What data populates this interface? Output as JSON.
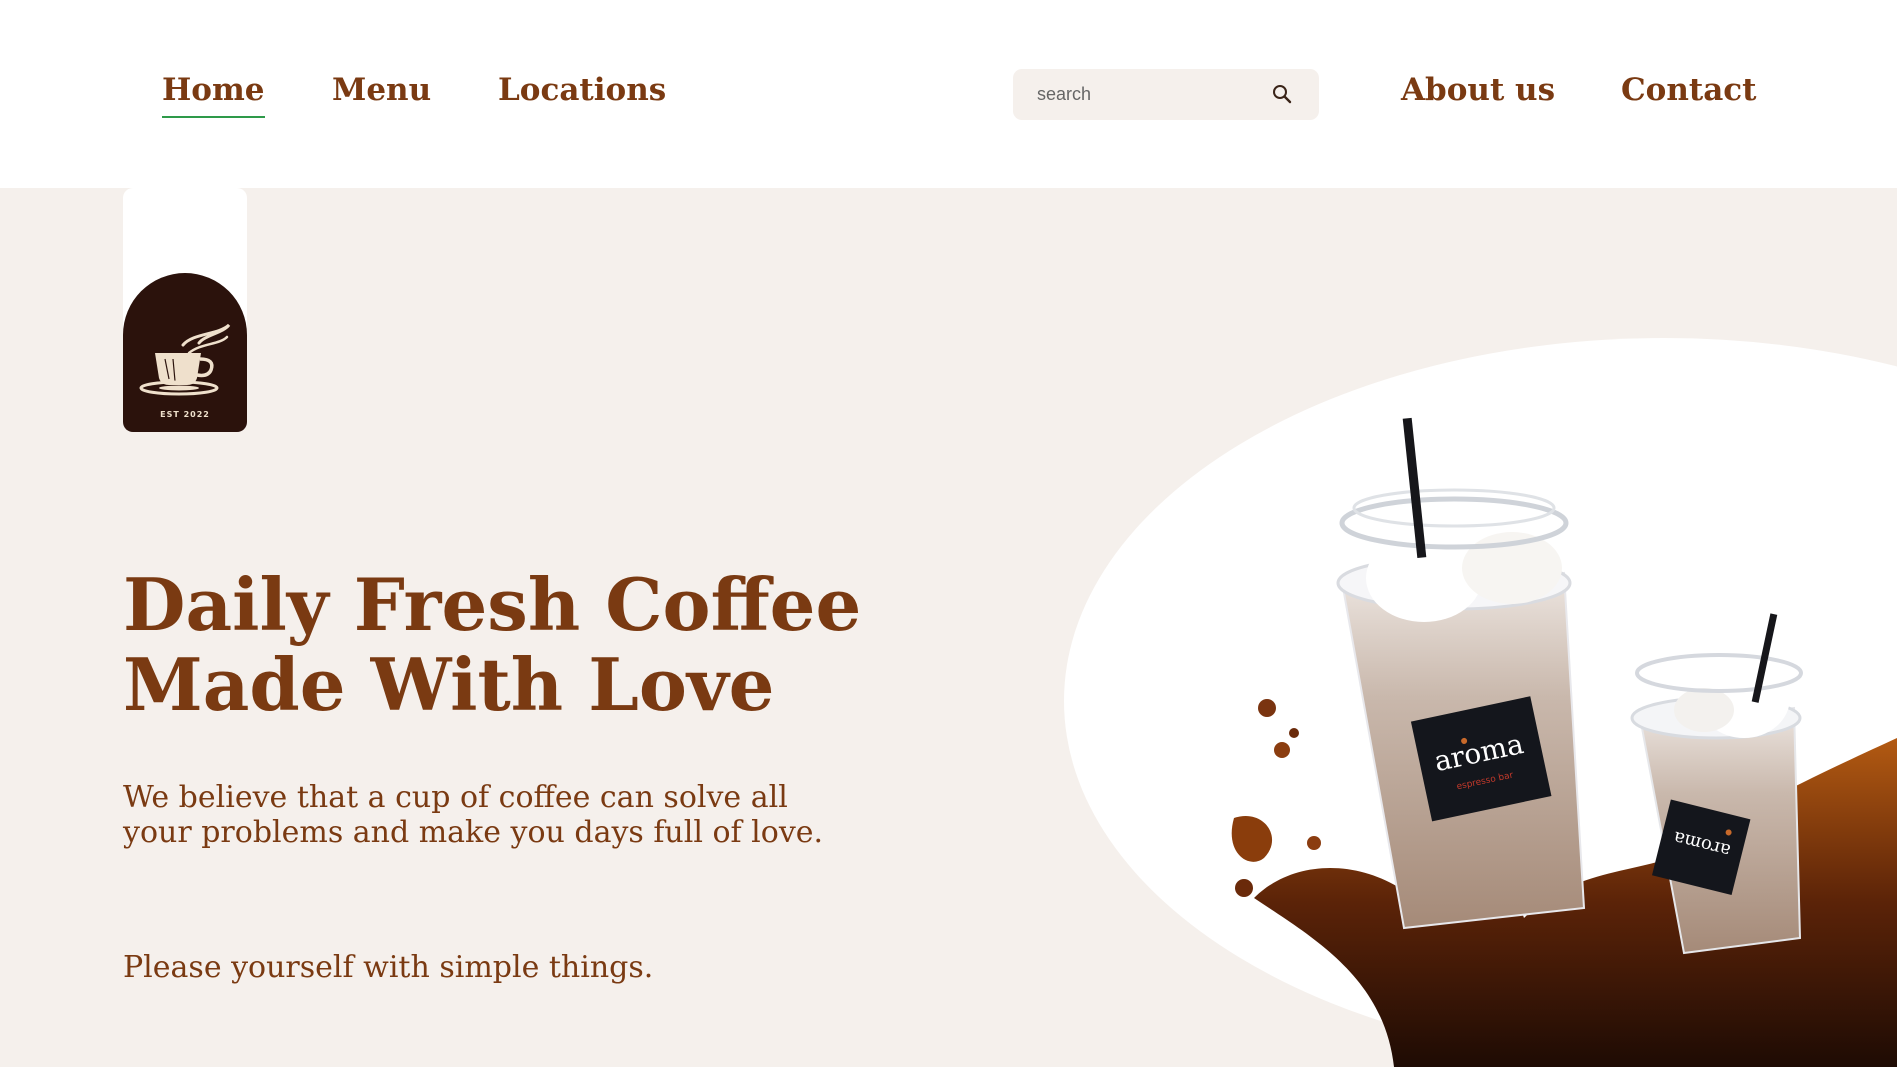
{
  "nav": {
    "home": "Home",
    "menu": "Menu",
    "locations": "Locations",
    "about": "About us",
    "contact": "Contact"
  },
  "search": {
    "placeholder": "search",
    "icon": "search-icon"
  },
  "logo": {
    "est": "EST 2022",
    "icon": "coffee-cup-icon"
  },
  "hero": {
    "headline_line1": "Daily Fresh Coffee",
    "headline_line2": "Made With Love",
    "tagline_line1": "We believe that a cup of coffee can solve all",
    "tagline_line2": "your problems and make you days full of love.",
    "tagline2": "Please yourself with simple things."
  },
  "product": {
    "cup_label_large": "aroma",
    "cup_label_small": "aroma",
    "cup_sublabel": "espresso bar"
  },
  "colors": {
    "brand_brown": "#7a3a12",
    "hero_background": "#f5f0ec",
    "logo_dark": "#2b120c",
    "active_underline": "#2e9a4a"
  }
}
